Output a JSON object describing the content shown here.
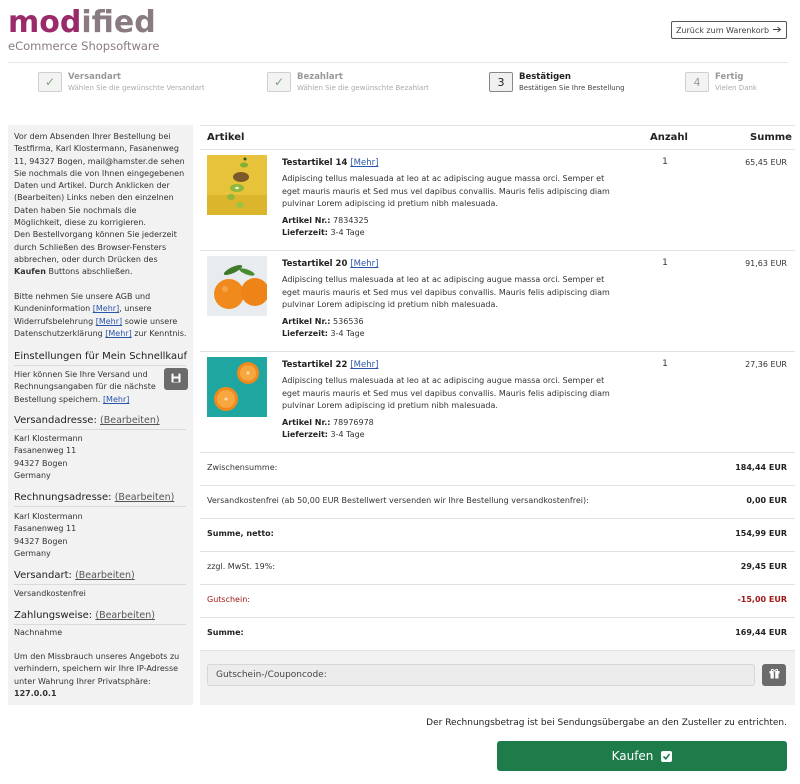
{
  "header": {
    "logo_text": "modified",
    "logo_sub": "eCommerce Shopsoftware",
    "back_label": "Zurück zum Warenkorb"
  },
  "steps": [
    {
      "marker": "✓",
      "title": "Versandart",
      "desc": "Wählen Sie die gewünschte Versandart"
    },
    {
      "marker": "✓",
      "title": "Bezahlart",
      "desc": "Wählen Sie die gewünschte Bezahlart"
    },
    {
      "marker": "3",
      "title": "Bestätigen",
      "desc": "Bestätigen Sie Ihre Bestellung"
    },
    {
      "marker": "4",
      "title": "Fertig",
      "desc": "Vielen Dank"
    }
  ],
  "sidebar": {
    "intro_p1": "Vor dem Absenden Ihrer Bestellung bei Testfirma, Karl Klostermann, Fasanenweg 11, 94327 Bogen, mail@hamster.de sehen Sie nochmals die von Ihnen eingegebenen Daten und Artikel. Durch Anklicken der (Bearbeiten) Links neben den einzelnen Daten haben Sie nochmals die Möglichkeit, diese zu korrigieren.",
    "intro_p2_a": "Den Bestellvorgang können Sie jederzeit durch Schließen des Browser-Fensters abbrechen, oder durch Drücken des ",
    "intro_p2_bold": "Kaufen",
    "intro_p2_b": " Buttons abschließen.",
    "terms_a": "Bitte nehmen Sie unsere AGB und Kundeninformation ",
    "terms_link1": "[Mehr]",
    "terms_b": ", unsere Widerrufsbelehrung ",
    "terms_link2": "[Mehr]",
    "terms_c": " sowie unsere Datenschutzerklärung ",
    "terms_link3": "[Mehr]",
    "terms_d": " zur Kenntnis.",
    "quick_heading": "Einstellungen für Mein Schnellkauf",
    "quick_text": "Hier können Sie Ihre Versand und Rechnungsangaben für die nächste Bestellung speichern. ",
    "quick_link": "[Mehr]",
    "shipping_heading": "Versandadresse:",
    "edit_label": "(Bearbeiten)",
    "shipping_address": [
      "Karl Klostermann",
      "Fasanenweg 11",
      "94327 Bogen",
      "Germany"
    ],
    "billing_heading": "Rechnungsadresse:",
    "billing_address": [
      "Karl Klostermann",
      "Fasanenweg 11",
      "94327 Bogen",
      "Germany"
    ],
    "ship_method_heading": "Versandart:",
    "ship_method_value": "Versandkostenfrei",
    "payment_heading": "Zahlungsweise:",
    "payment_value": "Nachnahme",
    "ip_text": "Um den Missbrauch unseres Angebots zu verhindern, speichern wir Ihre IP-Adresse unter Wahrung Ihrer Privatsphäre: ",
    "ip_value": "127.0.0.1"
  },
  "table": {
    "col_article": "Artikel",
    "col_qty": "Anzahl",
    "col_sum": "Summe",
    "more_label": "[Mehr]",
    "artnr_label": "Artikel Nr.:",
    "delivery_label": "Lieferzeit:",
    "products": [
      {
        "name": "Testartikel 14",
        "desc": "Adipiscing tellus malesuada at leo at ac adipiscing augue massa orci. Semper et eget mauris mauris et Sed mus vel dapibus convallis. Mauris felis adipiscing diam pulvinar Lorem adipiscing id pretium nibh malesuada.",
        "artnr": "7834325",
        "delivery": "3-4 Tage",
        "qty": "1",
        "price": "65,45 EUR"
      },
      {
        "name": "Testartikel 20",
        "desc": "Adipiscing tellus malesuada at leo at ac adipiscing augue massa orci. Semper et eget mauris mauris et Sed mus vel dapibus convallis. Mauris felis adipiscing diam pulvinar Lorem adipiscing id pretium nibh malesuada.",
        "artnr": "536536",
        "delivery": "3-4 Tage",
        "qty": "1",
        "price": "91,63 EUR"
      },
      {
        "name": "Testartikel 22",
        "desc": "Adipiscing tellus malesuada at leo at ac adipiscing augue massa orci. Semper et eget mauris mauris et Sed mus vel dapibus convallis. Mauris felis adipiscing diam pulvinar Lorem adipiscing id pretium nibh malesuada.",
        "artnr": "78976978",
        "delivery": "3-4 Tage",
        "qty": "1",
        "price": "27,36 EUR"
      }
    ]
  },
  "totals": [
    {
      "label": "Zwischensumme:",
      "value": "184,44 EUR"
    },
    {
      "label": "Versandkostenfrei (ab 50,00 EUR Bestellwert versenden wir Ihre Bestellung versandkostenfrei):",
      "value": "0,00 EUR"
    },
    {
      "label": "Summe, netto:",
      "value": "154,99 EUR"
    },
    {
      "label": "zzgl. MwSt. 19%:",
      "value": "29,45 EUR"
    },
    {
      "label": "Gutschein:",
      "value": "-15,00 EUR"
    },
    {
      "label": "Summe:",
      "value": "169,44 EUR"
    }
  ],
  "coupon": {
    "placeholder": "Gutschein-/Couponcode:"
  },
  "footer": {
    "note": "Der Rechnungsbetrag ist bei Sendungsübergabe an den Zusteller zu entrichten.",
    "buy_label": "Kaufen"
  },
  "colors": {
    "brand": "#9a2a6a",
    "buy_button": "#1d7c4a",
    "voucher_red": "#a01818"
  }
}
